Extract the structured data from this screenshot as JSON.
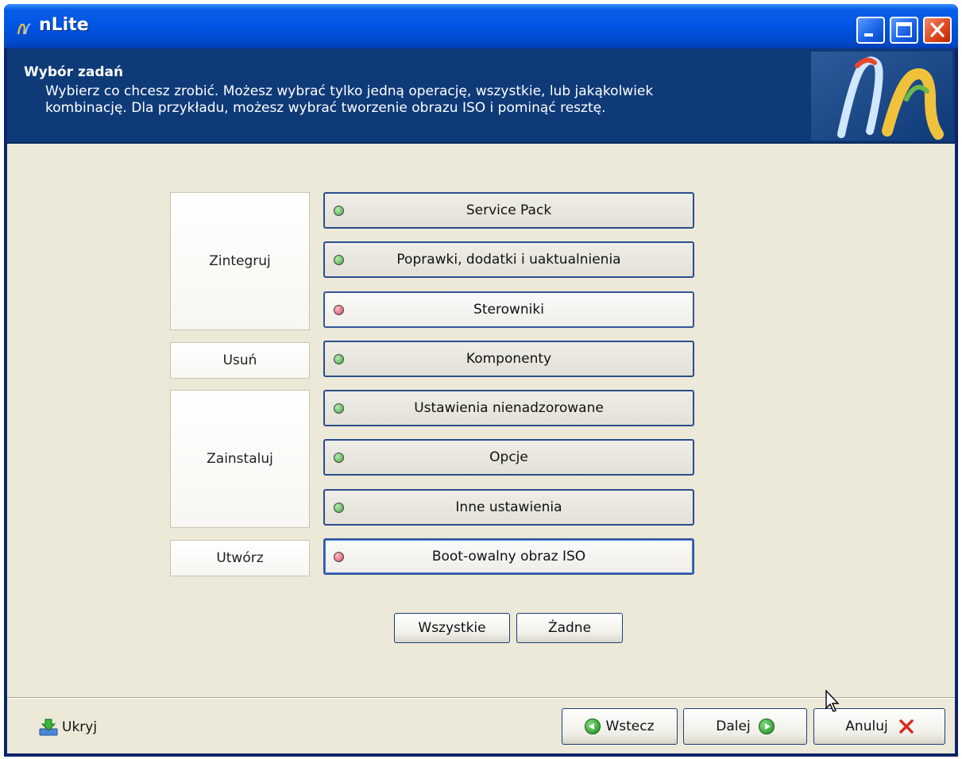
{
  "window": {
    "title": "nLite"
  },
  "header": {
    "title": "Wybór zadań",
    "description_line1": "Wybierz co chcesz zrobić. Możesz wybrać tylko jedną operację, wszystkie, lub jakąkolwiek",
    "description_line2": "kombinację. Dla przykładu, możesz wybrać tworzenie obrazu ISO i pominąć resztę."
  },
  "groups": {
    "integrate": "Zintegruj",
    "remove": "Usuń",
    "install": "Zainstaluj",
    "create": "Utwórz"
  },
  "tasks": [
    {
      "label": "Service Pack",
      "status": "on"
    },
    {
      "label": "Poprawki, dodatki i uaktualnienia",
      "status": "on"
    },
    {
      "label": "Sterowniki",
      "status": "off"
    },
    {
      "label": "Komponenty",
      "status": "on"
    },
    {
      "label": "Ustawienia nienadzorowane",
      "status": "on"
    },
    {
      "label": "Opcje",
      "status": "on"
    },
    {
      "label": "Inne ustawienia",
      "status": "on"
    },
    {
      "label": "Boot-owalny obraz ISO",
      "status": "off"
    }
  ],
  "selection": {
    "all_label": "Wszystkie",
    "none_label": "Żadne"
  },
  "footer": {
    "hide_label": "Ukryj",
    "back_label": "Wstecz",
    "next_label": "Dalej",
    "cancel_label": "Anuluj"
  },
  "colors": {
    "status_on": "#45a042",
    "status_off": "#d0405a",
    "header_bg": "#0e3a78",
    "titlebar": "#0054e3"
  },
  "icons": {
    "app": "nlite-icon",
    "minimize": "minimize-icon",
    "maximize": "maximize-icon",
    "close": "close-icon",
    "hide": "download-tray-icon",
    "back": "arrow-left-icon",
    "next": "arrow-right-icon",
    "cancel": "x-icon"
  }
}
